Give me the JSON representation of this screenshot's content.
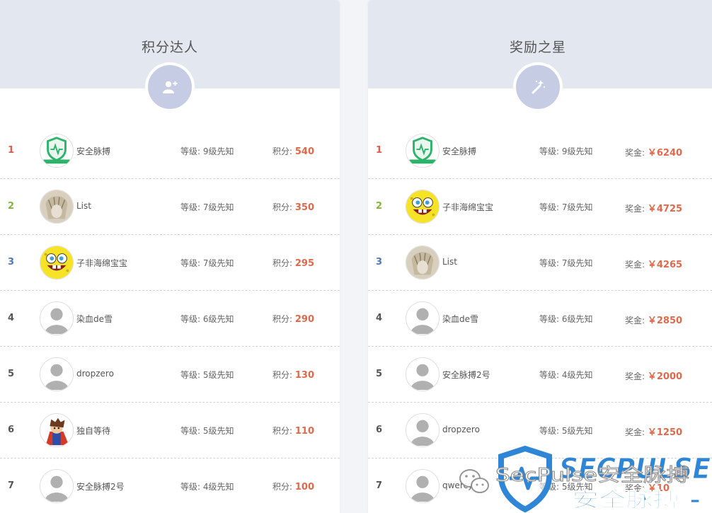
{
  "level_label": "等级: ",
  "colors": {
    "header_bg": "#e3e7ef",
    "badge": "#c6cce4",
    "rank": [
      "#e25b4c",
      "#86b33e",
      "#5077b3",
      "#555555"
    ],
    "value": "#e0694c",
    "watermark_blue": "#2f86d6"
  },
  "panels": [
    {
      "title": "积分达人",
      "icon": "user-plus-icon",
      "value_label": "积分: ",
      "rows": [
        {
          "rank": "1",
          "avatar": "secpulse",
          "name": "安全脉搏",
          "level": "9级先知",
          "value": "540"
        },
        {
          "rank": "2",
          "avatar": "sketch",
          "name": "List",
          "level": "7级先知",
          "value": "350"
        },
        {
          "rank": "3",
          "avatar": "sponge",
          "name": "子非海绵宝宝",
          "level": "7级先知",
          "value": "295"
        },
        {
          "rank": "4",
          "avatar": "default",
          "name": "染血de雪",
          "level": "6级先知",
          "value": "290"
        },
        {
          "rank": "5",
          "avatar": "default",
          "name": "dropzero",
          "level": "5级先知",
          "value": "130"
        },
        {
          "rank": "6",
          "avatar": "hero",
          "name": "独自等待",
          "level": "5级先知",
          "value": "110"
        },
        {
          "rank": "7",
          "avatar": "default",
          "name": "安全脉搏2号",
          "level": "4级先知",
          "value": "100"
        }
      ]
    },
    {
      "title": "奖励之星",
      "icon": "magic-wand-icon",
      "value_label": "奖金: ",
      "rows": [
        {
          "rank": "1",
          "avatar": "secpulse",
          "name": "安全脉搏",
          "level": "9级先知",
          "value": "￥6240"
        },
        {
          "rank": "2",
          "avatar": "sponge",
          "name": "子非海绵宝宝",
          "level": "7级先知",
          "value": "￥4725"
        },
        {
          "rank": "3",
          "avatar": "sketch",
          "name": "List",
          "level": "7级先知",
          "value": "￥4265"
        },
        {
          "rank": "4",
          "avatar": "default",
          "name": "染血de雪",
          "level": "6级先知",
          "value": "￥2850"
        },
        {
          "rank": "5",
          "avatar": "default",
          "name": "安全脉搏2号",
          "level": "4级先知",
          "value": "￥2000"
        },
        {
          "rank": "6",
          "avatar": "default",
          "name": "dropzero",
          "level": "5级先知",
          "value": "￥1250"
        },
        {
          "rank": "7",
          "avatar": "default",
          "name": "qwercy",
          "level": "5级先知",
          "value": "￥10"
        }
      ]
    }
  ],
  "watermark": {
    "wechat_text": "SecPulse安全脉搏",
    "logo_text": "SECPULSE",
    "logo_subtext": "安全脉搏 -"
  }
}
